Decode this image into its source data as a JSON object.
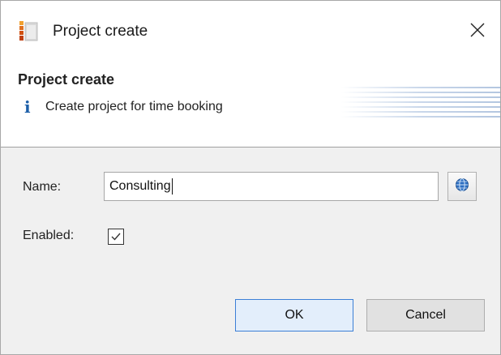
{
  "window": {
    "title": "Project create",
    "icon": "project-app-icon",
    "close_icon": "close-icon"
  },
  "banner": {
    "title": "Project create",
    "info_icon_glyph": "i",
    "description": "Create project for time booking"
  },
  "form": {
    "name_label": "Name:",
    "name_value": "Consulting",
    "enabled_label": "Enabled:",
    "enabled_checked": true,
    "globe_icon": "globe-icon"
  },
  "buttons": {
    "ok_label": "OK",
    "cancel_label": "Cancel"
  },
  "colors": {
    "info_icon": "#1d5fa8",
    "ok_border": "#3c7fd6",
    "ok_background": "#e3eefb",
    "content_background": "#f0f0f0"
  }
}
